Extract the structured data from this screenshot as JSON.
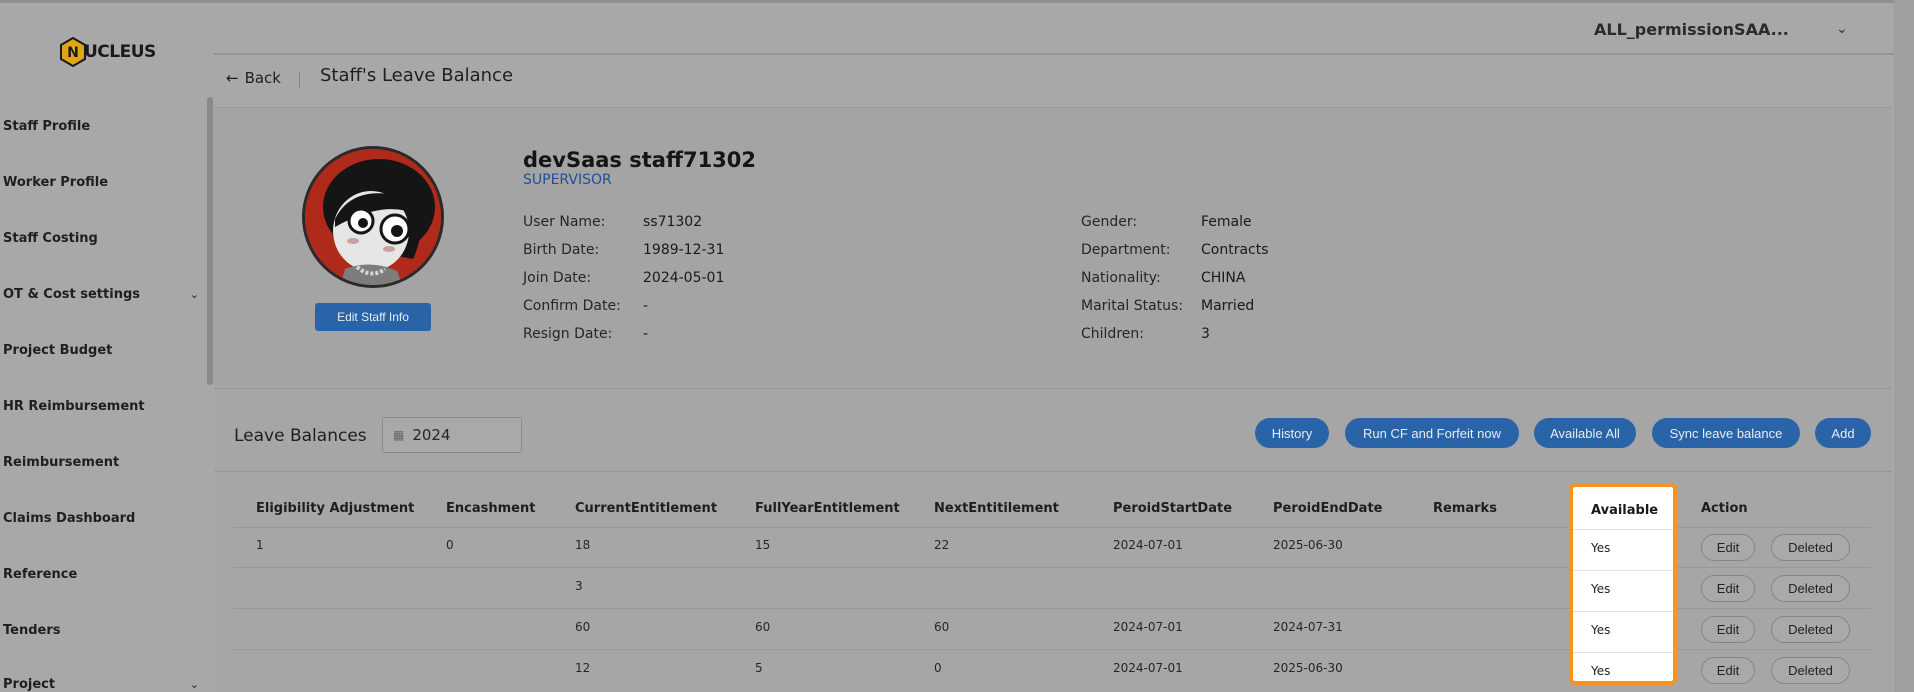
{
  "app": {
    "logo_text": "UCLEUS",
    "logo_letter": "N",
    "tenant": "ALL_permissionSAA..."
  },
  "sidebar": {
    "items": [
      {
        "label": "Staff Profile",
        "has_children": false
      },
      {
        "label": "Worker Profile",
        "has_children": false
      },
      {
        "label": "Staff Costing",
        "has_children": false
      },
      {
        "label": "OT & Cost settings",
        "has_children": true
      },
      {
        "label": "Project Budget",
        "has_children": false
      },
      {
        "label": "HR Reimbursement",
        "has_children": false
      },
      {
        "label": "Reimbursement",
        "has_children": false
      },
      {
        "label": "Claims Dashboard",
        "has_children": false
      },
      {
        "label": "Reference",
        "has_children": false
      },
      {
        "label": "Tenders",
        "has_children": false
      },
      {
        "label": "Project",
        "has_children": true
      }
    ]
  },
  "header": {
    "back_label": "Back",
    "title": "Staff's Leave Balance"
  },
  "profile": {
    "name": "devSaas staff71302",
    "role": "SUPERVISOR",
    "edit_label": "Edit Staff Info",
    "left_fields": [
      {
        "key": "User Name:",
        "value": "ss71302"
      },
      {
        "key": "Birth Date:",
        "value": "1989-12-31"
      },
      {
        "key": "Join Date:",
        "value": "2024-05-01"
      },
      {
        "key": "Confirm Date:",
        "value": "-"
      },
      {
        "key": "Resign Date:",
        "value": "-"
      }
    ],
    "right_fields": [
      {
        "key": "Gender:",
        "value": "Female"
      },
      {
        "key": "Department:",
        "value": "Contracts"
      },
      {
        "key": "Nationality:",
        "value": "CHINA"
      },
      {
        "key": "Marital Status:",
        "value": "Married"
      },
      {
        "key": "Children:",
        "value": "3"
      }
    ]
  },
  "leave_balances": {
    "title": "Leave Balances",
    "year": "2024",
    "buttons": {
      "history": "History",
      "run_cf": "Run CF and Forfeit now",
      "available_all": "Available All",
      "sync": "Sync leave balance",
      "add": "Add"
    },
    "columns": {
      "eligibility": "Eligibility Adjustment",
      "encashment": "Encashment",
      "current": "CurrentEntitlement",
      "fullyear": "FullYearEntitlement",
      "next": "NextEntitilement",
      "start": "PeroidStartDate",
      "end": "PeroidEndDate",
      "remarks": "Remarks",
      "available": "Available",
      "action": "Action"
    },
    "rows": [
      {
        "eligibility": "1",
        "encashment": "0",
        "current": "18",
        "fullyear": "15",
        "next": "22",
        "start": "2024-07-01",
        "end": "2025-06-30",
        "remarks": "",
        "available": "Yes"
      },
      {
        "eligibility": "",
        "encashment": "",
        "current": "3",
        "fullyear": "",
        "next": "",
        "start": "",
        "end": "",
        "remarks": "",
        "available": "Yes"
      },
      {
        "eligibility": "",
        "encashment": "",
        "current": "60",
        "fullyear": "60",
        "next": "60",
        "start": "2024-07-01",
        "end": "2024-07-31",
        "remarks": "",
        "available": "Yes"
      },
      {
        "eligibility": "",
        "encashment": "",
        "current": "12",
        "fullyear": "5",
        "next": "0",
        "start": "2024-07-01",
        "end": "2025-06-30",
        "remarks": "",
        "available": "Yes"
      }
    ],
    "row_actions": {
      "edit": "Edit",
      "delete": "Deleted"
    }
  },
  "colors": {
    "primary": "#2a64a8",
    "highlight": "#f5941f",
    "role_link": "#1f4f9a"
  }
}
